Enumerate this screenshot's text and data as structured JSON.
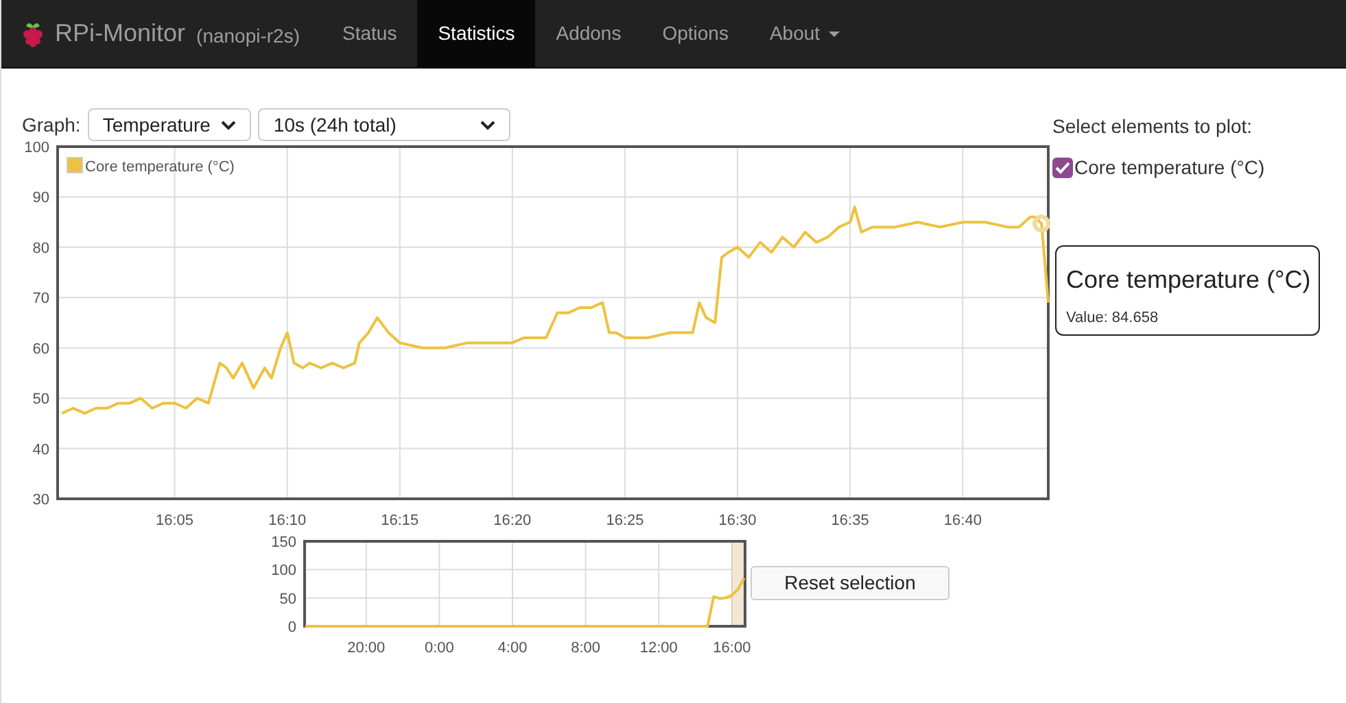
{
  "navbar": {
    "brand": "RPi-Monitor",
    "host": "(nanopi-r2s)",
    "items": [
      {
        "label": "Status",
        "selected": false,
        "dropdown": false
      },
      {
        "label": "Statistics",
        "selected": true,
        "dropdown": false
      },
      {
        "label": "Addons",
        "selected": false,
        "dropdown": false
      },
      {
        "label": "Options",
        "selected": false,
        "dropdown": false
      },
      {
        "label": "About",
        "selected": false,
        "dropdown": true
      }
    ]
  },
  "controls": {
    "label": "Graph:",
    "graph_select": {
      "value": "Temperature"
    },
    "period_select": {
      "value": "10s (24h total)"
    }
  },
  "main_chart": {
    "chart_data": {
      "type": "line",
      "grid": true,
      "xlim": [
        15.9967,
        16.73
      ],
      "ylim": [
        30,
        100
      ],
      "x": [
        16,
        16.0083,
        16.0167,
        16.025,
        16.0333,
        16.0417,
        16.05,
        16.0583,
        16.0667,
        16.075,
        16.0833,
        16.0917,
        16.1,
        16.1083,
        16.1167,
        16.1217,
        16.1267,
        16.1333,
        16.1417,
        16.15,
        16.155,
        16.1617,
        16.1667,
        16.1717,
        16.1783,
        16.1833,
        16.1917,
        16.2,
        16.2083,
        16.2167,
        16.22,
        16.2267,
        16.2333,
        16.2417,
        16.25,
        16.2667,
        16.2833,
        16.3,
        16.3167,
        16.3333,
        16.3417,
        16.35,
        16.3583,
        16.3667,
        16.375,
        16.3833,
        16.3917,
        16.4,
        16.405,
        16.41,
        16.4167,
        16.4333,
        16.45,
        16.4667,
        16.4717,
        16.4767,
        16.4833,
        16.4883,
        16.4933,
        16.5,
        16.5083,
        16.5167,
        16.525,
        16.5333,
        16.5417,
        16.55,
        16.5583,
        16.5667,
        16.575,
        16.5833,
        16.5867,
        16.5917,
        16.6,
        16.6167,
        16.6333,
        16.65,
        16.6667,
        16.6833,
        16.7,
        16.7083,
        16.7167,
        16.72,
        16.725,
        16.73
      ],
      "series": [
        {
          "name": "Core temperature (°C)",
          "color": "#edc240",
          "values": [
            47,
            48,
            47,
            48,
            48,
            49,
            49,
            50,
            48,
            49,
            49,
            48,
            50,
            49,
            57,
            56,
            54,
            57,
            52,
            56,
            54,
            60,
            63,
            57,
            56,
            57,
            56,
            57,
            56,
            57,
            61,
            63,
            66,
            63,
            61,
            60,
            60,
            61,
            61,
            61,
            62,
            62,
            62,
            67,
            67,
            68,
            68,
            69,
            63,
            63,
            62,
            62,
            63,
            63,
            69,
            66,
            65,
            78,
            79,
            80,
            78,
            81,
            79,
            82,
            80,
            83,
            81,
            82,
            84,
            85,
            88,
            83,
            84,
            84,
            85,
            84,
            85,
            85,
            84,
            84,
            86,
            86,
            84.7,
            69
          ]
        }
      ],
      "xticks": [
        {
          "value": 16.0833,
          "label": "16:05"
        },
        {
          "value": 16.1667,
          "label": "16:10"
        },
        {
          "value": 16.25,
          "label": "16:15"
        },
        {
          "value": 16.3333,
          "label": "16:20"
        },
        {
          "value": 16.4167,
          "label": "16:25"
        },
        {
          "value": 16.5,
          "label": "16:30"
        },
        {
          "value": 16.5833,
          "label": "16:35"
        },
        {
          "value": 16.6667,
          "label": "16:40"
        }
      ],
      "yticks": [
        30,
        40,
        50,
        60,
        70,
        80,
        90,
        100
      ]
    }
  },
  "overview": {
    "chart_data": {
      "type": "line",
      "grid": true,
      "ylim": [
        0,
        150
      ],
      "categories": [
        null,
        null,
        null,
        null,
        null,
        null,
        null,
        null,
        null,
        null,
        "20:00",
        null,
        null,
        null,
        null,
        null,
        null,
        null,
        null,
        null,
        null,
        null,
        "0:00",
        null,
        null,
        null,
        null,
        null,
        null,
        null,
        null,
        null,
        null,
        null,
        "4:00",
        null,
        null,
        null,
        null,
        null,
        null,
        null,
        null,
        null,
        null,
        null,
        "8:00",
        null,
        null,
        null,
        null,
        null,
        null,
        null,
        null,
        null,
        null,
        null,
        "12:00",
        null,
        null,
        null,
        null,
        null,
        null,
        null,
        null,
        null,
        null,
        null,
        "16:00",
        null,
        null
      ],
      "series": [
        {
          "color": "#edc240",
          "values": [
            0,
            0,
            0,
            0,
            0,
            0,
            0,
            0,
            0,
            0,
            0,
            0,
            0,
            0,
            0,
            0,
            0,
            0,
            0,
            0,
            0,
            0,
            0,
            0,
            0,
            0,
            0,
            0,
            0,
            0,
            0,
            0,
            0,
            0,
            0,
            0,
            0,
            0,
            0,
            0,
            0,
            0,
            0,
            0,
            0,
            0,
            0,
            0,
            0,
            0,
            0,
            0,
            0,
            0,
            0,
            0,
            0,
            0,
            0,
            0,
            0,
            0,
            0,
            0,
            0,
            0,
            0,
            52,
            49,
            50,
            55,
            65,
            85
          ]
        }
      ],
      "yticks": [
        0,
        50,
        100,
        150
      ]
    }
  },
  "reset_button": "Reset selection",
  "plot_selector": {
    "title": "Select elements to plot:",
    "items": [
      {
        "label": "Core temperature (°C)",
        "checked": true
      }
    ]
  },
  "tooltip": {
    "title": "Core temperature (°C)",
    "value": "Value: 84.658"
  }
}
